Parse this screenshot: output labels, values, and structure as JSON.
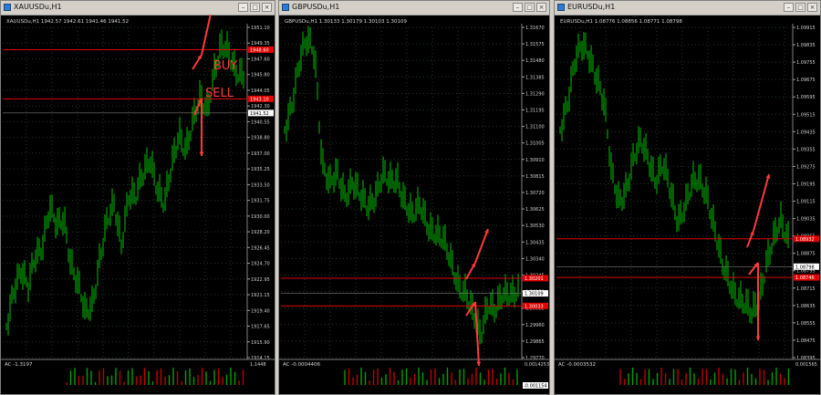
{
  "colors": {
    "candle": "#00c000",
    "grid": "#1e3c1e",
    "axis": "#d0d0d0",
    "level": "#e00000",
    "arrow": "#ff3a3a",
    "ac_up": "#00a000",
    "ac_down": "#c00000"
  },
  "window_buttons": [
    "–",
    "□",
    "×"
  ],
  "windows": [
    {
      "id": "xau",
      "title": "XAUUSDu,H1",
      "header": "XAUUSDu,H1  1942.57 1942.61 1941.46 1941.52",
      "price_ticks": [
        "1951.10",
        "1949.35",
        "1947.60",
        "1945.80",
        "1944.05",
        "1942.30",
        "1940.55",
        "1938.80",
        "1937.00",
        "1935.25",
        "1933.50",
        "1931.75",
        "1930.00",
        "1928.20",
        "1926.45",
        "1924.70",
        "1922.95",
        "1921.15",
        "1919.40",
        "1917.65",
        "1915.90",
        "1914.15"
      ],
      "ylim": [
        1914.15,
        1951.1
      ],
      "levels": [
        {
          "price": 1948.6,
          "label": "1948.60"
        },
        {
          "price": 1943.1,
          "label": "1943.10"
        }
      ],
      "current": {
        "price": 1941.52,
        "label": "1941.52"
      },
      "ac": {
        "label": "AC -1.3197",
        "scale_top": "1.1448",
        "scale_bottom": ""
      },
      "annotations": [
        {
          "text": "BUY"
        },
        {
          "text": "SELL"
        }
      ]
    },
    {
      "id": "gbp",
      "title": "GBPUSDu,H1",
      "header": "GBPUSDu,H1  1.30133 1.30179 1.30103 1.30109",
      "price_ticks": [
        "1.31670",
        "1.31575",
        "1.31480",
        "1.31385",
        "1.31290",
        "1.31195",
        "1.31100",
        "1.31005",
        "1.30910",
        "1.30815",
        "1.30720",
        "1.30625",
        "1.30530",
        "1.30435",
        "1.30340",
        "1.30245",
        "1.30150",
        "1.30055",
        "1.29960",
        "1.29865",
        "1.29770"
      ],
      "ylim": [
        1.2972,
        1.3172
      ],
      "levels": [
        {
          "price": 1.30201,
          "label": "1.30201"
        },
        {
          "price": 1.30033,
          "label": "1.30033"
        }
      ],
      "current": {
        "price": 1.30109,
        "label": "1.30109"
      },
      "ac": {
        "label": "AC -0.0004406",
        "scale_top": "0.0014253",
        "scale_bottom": "-0.001154"
      },
      "annotations": []
    },
    {
      "id": "eur",
      "title": "EURUSDu,H1",
      "header": "EURUSDu,H1  1.08776 1.08856 1.08771 1.08798",
      "price_ticks": [
        "1.09915",
        "1.09835",
        "1.09755",
        "1.09675",
        "1.09595",
        "1.09515",
        "1.09435",
        "1.09355",
        "1.09275",
        "1.09195",
        "1.09115",
        "1.09035",
        "1.08955",
        "1.08875",
        "1.08795",
        "1.08715",
        "1.08635",
        "1.08555",
        "1.08475",
        "1.08395"
      ],
      "ylim": [
        1.0836,
        1.0995
      ],
      "levels": [
        {
          "price": 1.08932,
          "label": "1.08932"
        },
        {
          "price": 1.08746,
          "label": "1.08746"
        }
      ],
      "current": {
        "price": 1.08798,
        "label": "1.08798"
      },
      "ac": {
        "label": "AC -0.0003532",
        "scale_top": "0.001565",
        "scale_bottom": ""
      },
      "annotations": []
    }
  ]
}
